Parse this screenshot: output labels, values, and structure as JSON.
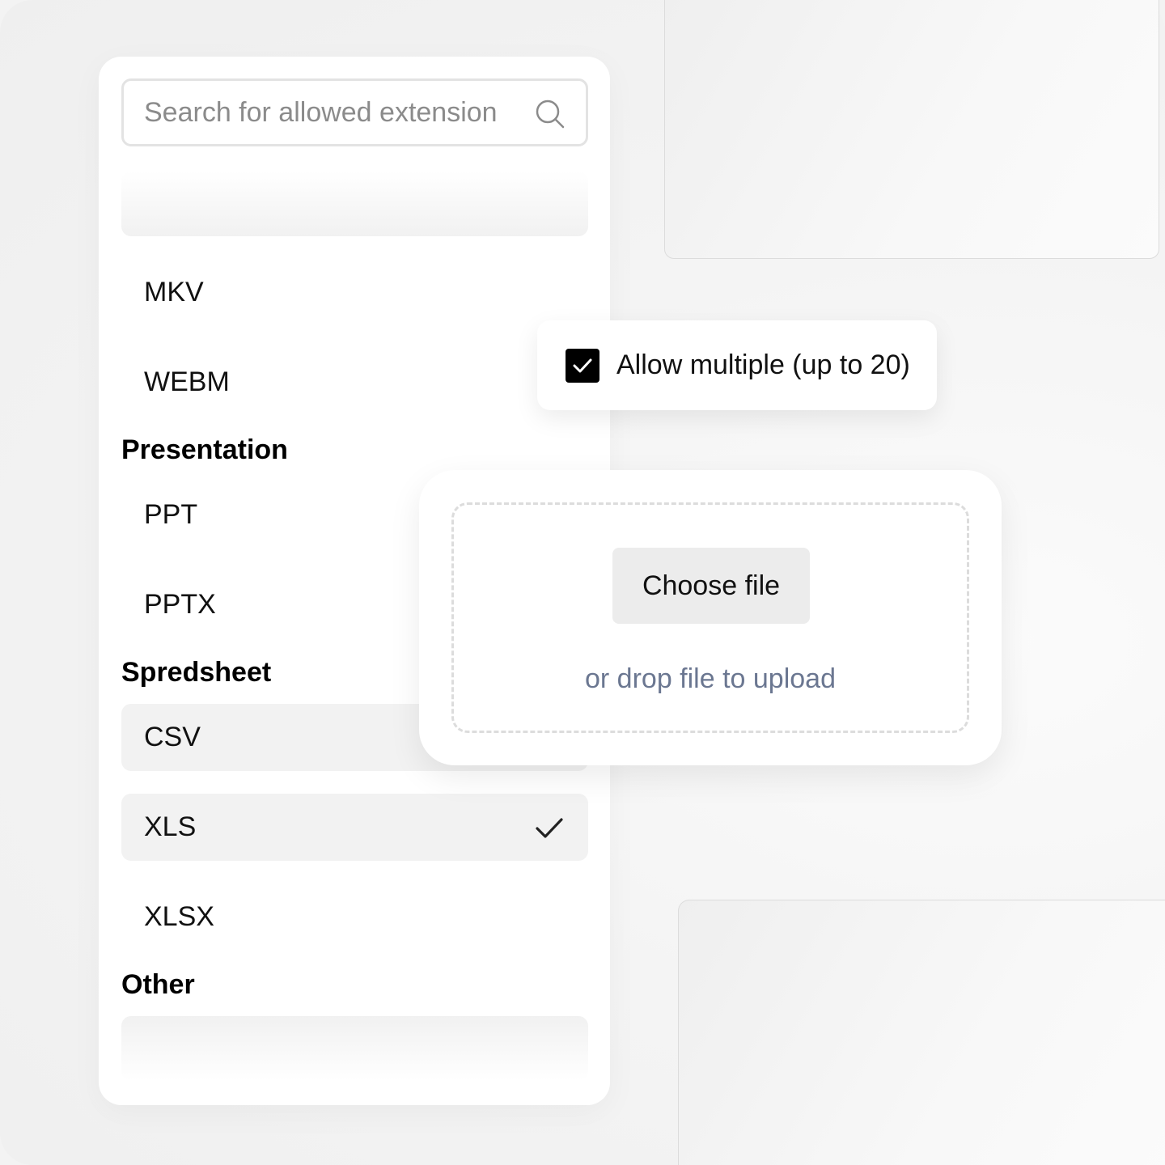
{
  "search": {
    "placeholder": "Search for allowed extension"
  },
  "extensions": {
    "video_items": [
      "MKV",
      "WEBM"
    ],
    "presentation": {
      "heading": "Presentation",
      "items": [
        "PPT",
        "PPTX"
      ]
    },
    "spreadsheet": {
      "heading": "Spredsheet",
      "items": [
        "CSV",
        "XLS",
        "XLSX"
      ],
      "selected": "XLS",
      "hovered": "CSV"
    },
    "other": {
      "heading": "Other"
    }
  },
  "allow_multiple": {
    "label": "Allow multiple (up to 20)",
    "checked": true
  },
  "upload": {
    "button_label": "Choose file",
    "drop_text": "or drop file to upload"
  },
  "colors": {
    "accent_text": "#6b7791",
    "checkbox": "#000000",
    "highlight": "#f2f2f2"
  }
}
